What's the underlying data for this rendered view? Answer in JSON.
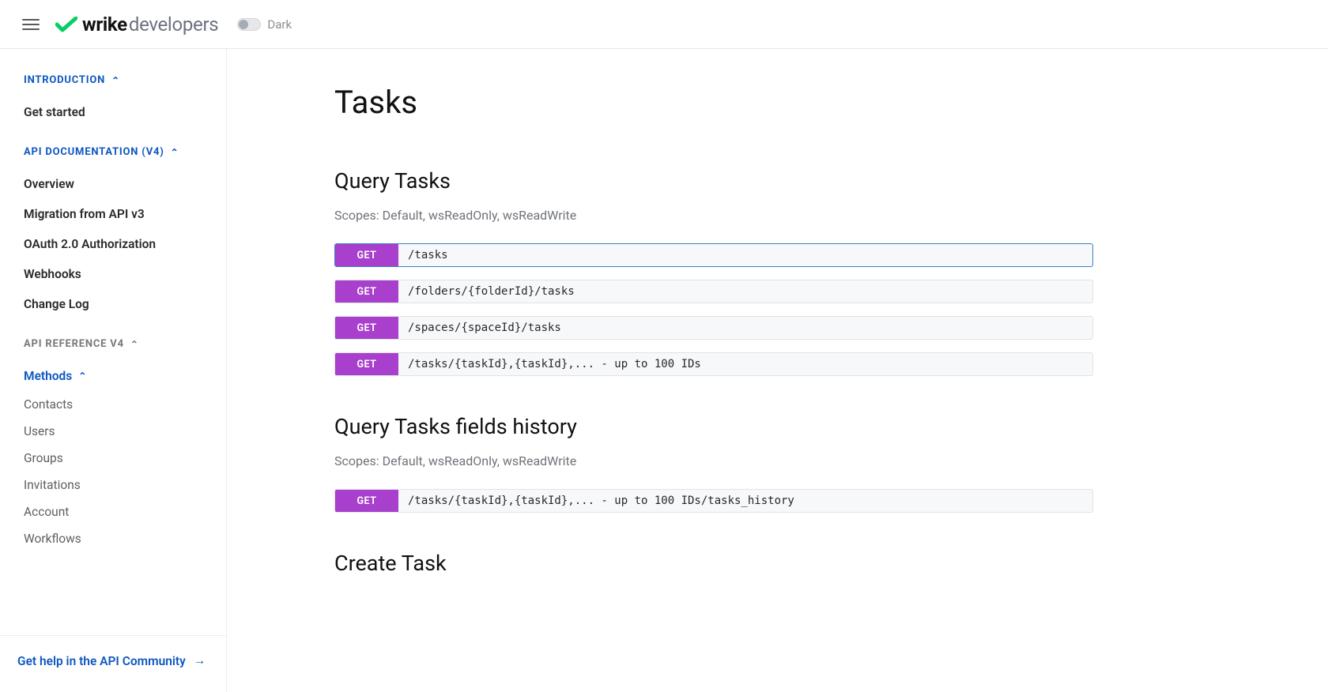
{
  "header": {
    "brand_main": "wrike",
    "brand_sub": "developers",
    "dark_label": "Dark"
  },
  "sidebar": {
    "sections": [
      {
        "title": "INTRODUCTION",
        "items": [
          {
            "label": "Get started",
            "kind": "item"
          }
        ]
      },
      {
        "title": "API DOCUMENTATION (V4)",
        "items": [
          {
            "label": "Overview",
            "kind": "item"
          },
          {
            "label": "Migration from API v3",
            "kind": "item"
          },
          {
            "label": "OAuth 2.0 Authorization",
            "kind": "item"
          },
          {
            "label": "Webhooks",
            "kind": "item"
          },
          {
            "label": "Change Log",
            "kind": "item"
          }
        ]
      },
      {
        "title": "API REFERENCE V4",
        "items": [
          {
            "label": "Methods",
            "kind": "expanded"
          },
          {
            "label": "Contacts",
            "kind": "sub"
          },
          {
            "label": "Users",
            "kind": "sub"
          },
          {
            "label": "Groups",
            "kind": "sub"
          },
          {
            "label": "Invitations",
            "kind": "sub"
          },
          {
            "label": "Account",
            "kind": "sub"
          },
          {
            "label": "Workflows",
            "kind": "sub"
          }
        ]
      }
    ],
    "footer_link": "Get help in the API Community"
  },
  "main": {
    "page_title": "Tasks",
    "sections": [
      {
        "heading": "Query Tasks",
        "scopes": "Scopes: Default, wsReadOnly, wsReadWrite",
        "endpoints": [
          {
            "method": "GET",
            "path": "/tasks",
            "active": true
          },
          {
            "method": "GET",
            "path": "/folders/{folderId}/tasks",
            "active": false
          },
          {
            "method": "GET",
            "path": "/spaces/{spaceId}/tasks",
            "active": false
          },
          {
            "method": "GET",
            "path": "/tasks/{taskId},{taskId},... - up to 100 IDs",
            "active": false
          }
        ]
      },
      {
        "heading": "Query Tasks fields history",
        "scopes": "Scopes: Default, wsReadOnly, wsReadWrite",
        "endpoints": [
          {
            "method": "GET",
            "path": "/tasks/{taskId},{taskId},... - up to 100 IDs/tasks_history",
            "active": false
          }
        ]
      },
      {
        "heading": "Create Task",
        "scopes": "",
        "endpoints": []
      }
    ]
  }
}
